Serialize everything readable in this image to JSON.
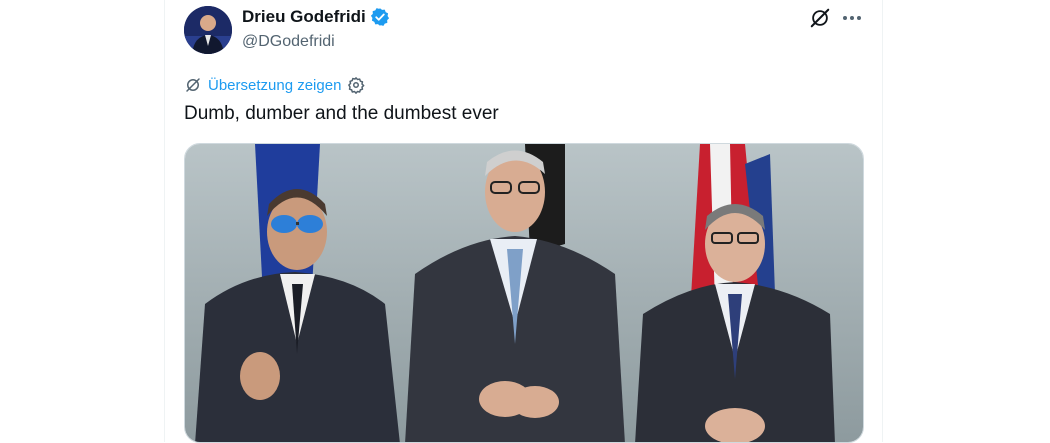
{
  "author": {
    "name": "Drieu Godefridi",
    "handle": "@DGodefridi",
    "verified": true,
    "verified_color": "#1d9bf0"
  },
  "actions": {
    "grok_icon": "grok-icon",
    "more_icon": "more-icon"
  },
  "translate": {
    "label": "Übersetzung zeigen"
  },
  "tweet": {
    "text": "Dumb, dumber and the dumbest ever"
  },
  "media": {
    "description": "Photo of three men in dark suits standing in front of flags"
  },
  "colors": {
    "link": "#1d9bf0",
    "text": "#0f1419",
    "secondary": "#536471"
  }
}
